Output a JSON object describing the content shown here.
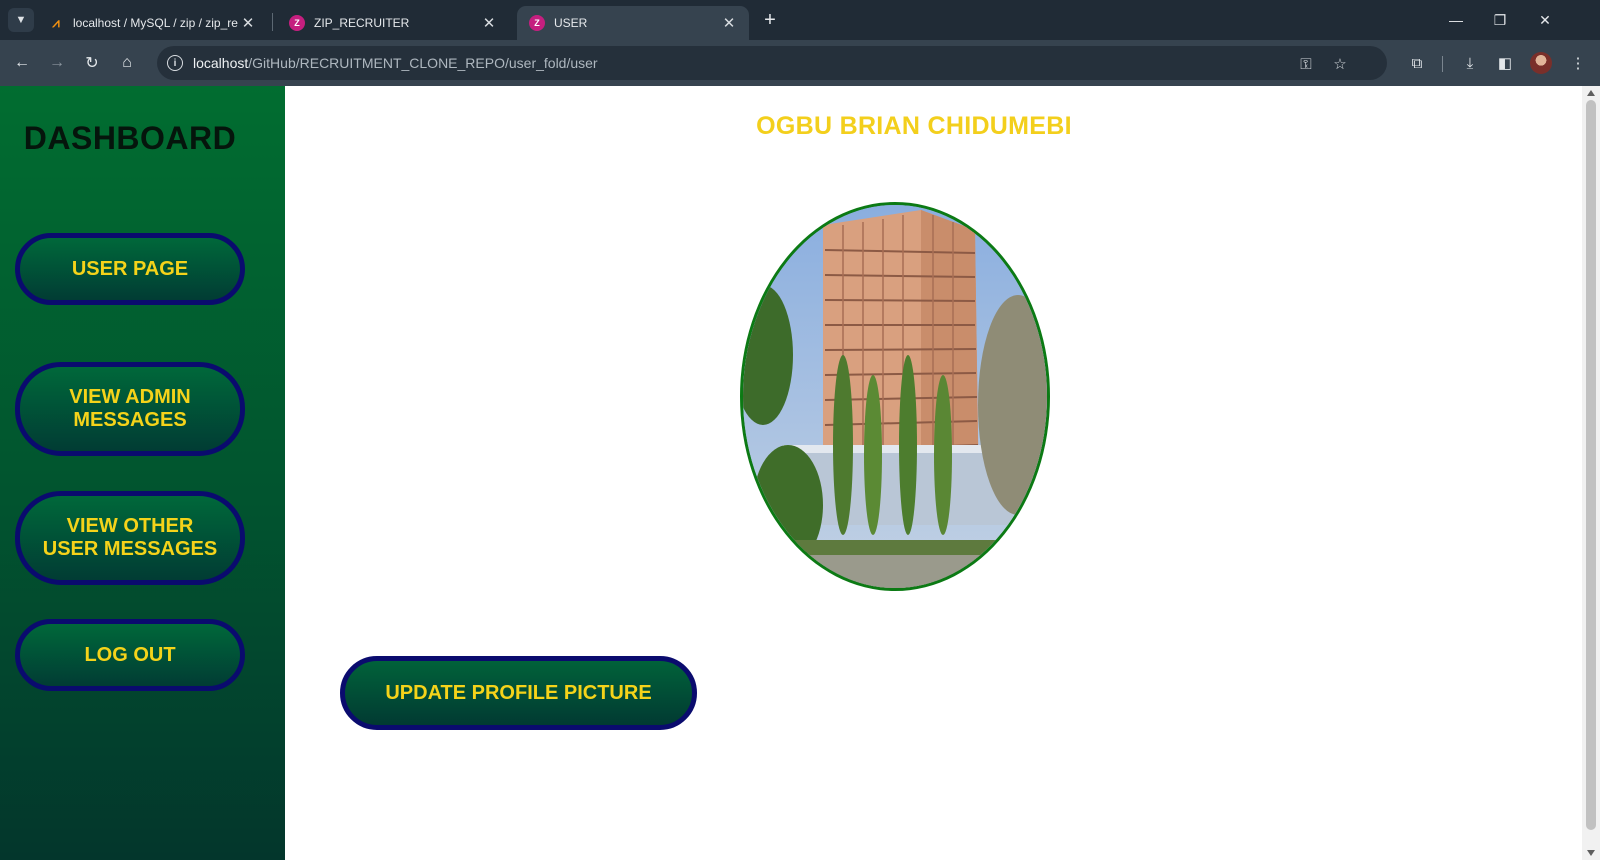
{
  "browser": {
    "tabs": [
      {
        "title": "localhost / MySQL / zip / zip_re",
        "icon": "phpmyadmin-icon",
        "active": false
      },
      {
        "title": "ZIP_RECRUITER",
        "icon": "site-favicon",
        "active": false
      },
      {
        "title": "USER",
        "icon": "site-favicon",
        "active": true
      }
    ],
    "url_host": "localhost",
    "url_path": "/GitHub/RECRUITMENT_CLONE_REPO/user_fold/user",
    "favicon_letter": "Z"
  },
  "sidebar": {
    "title": "DASHBOARD",
    "buttons": {
      "user_page": "USER PAGE",
      "admin_messages": "VIEW ADMIN\nMESSAGES",
      "other_user_messages": "VIEW OTHER\nUSER MESSAGES",
      "logout": "LOG OUT"
    }
  },
  "main": {
    "user_name": "OGBU BRIAN CHIDUMEBI",
    "profile_picture_alt": "building",
    "update_button": "UPDATE PROFILE PICTURE"
  },
  "colors": {
    "sidebar_green": "#016d30",
    "button_text_yellow": "#f5d31a",
    "button_border_navy": "#0a0b6e",
    "name_yellow": "#f3cf1c"
  }
}
